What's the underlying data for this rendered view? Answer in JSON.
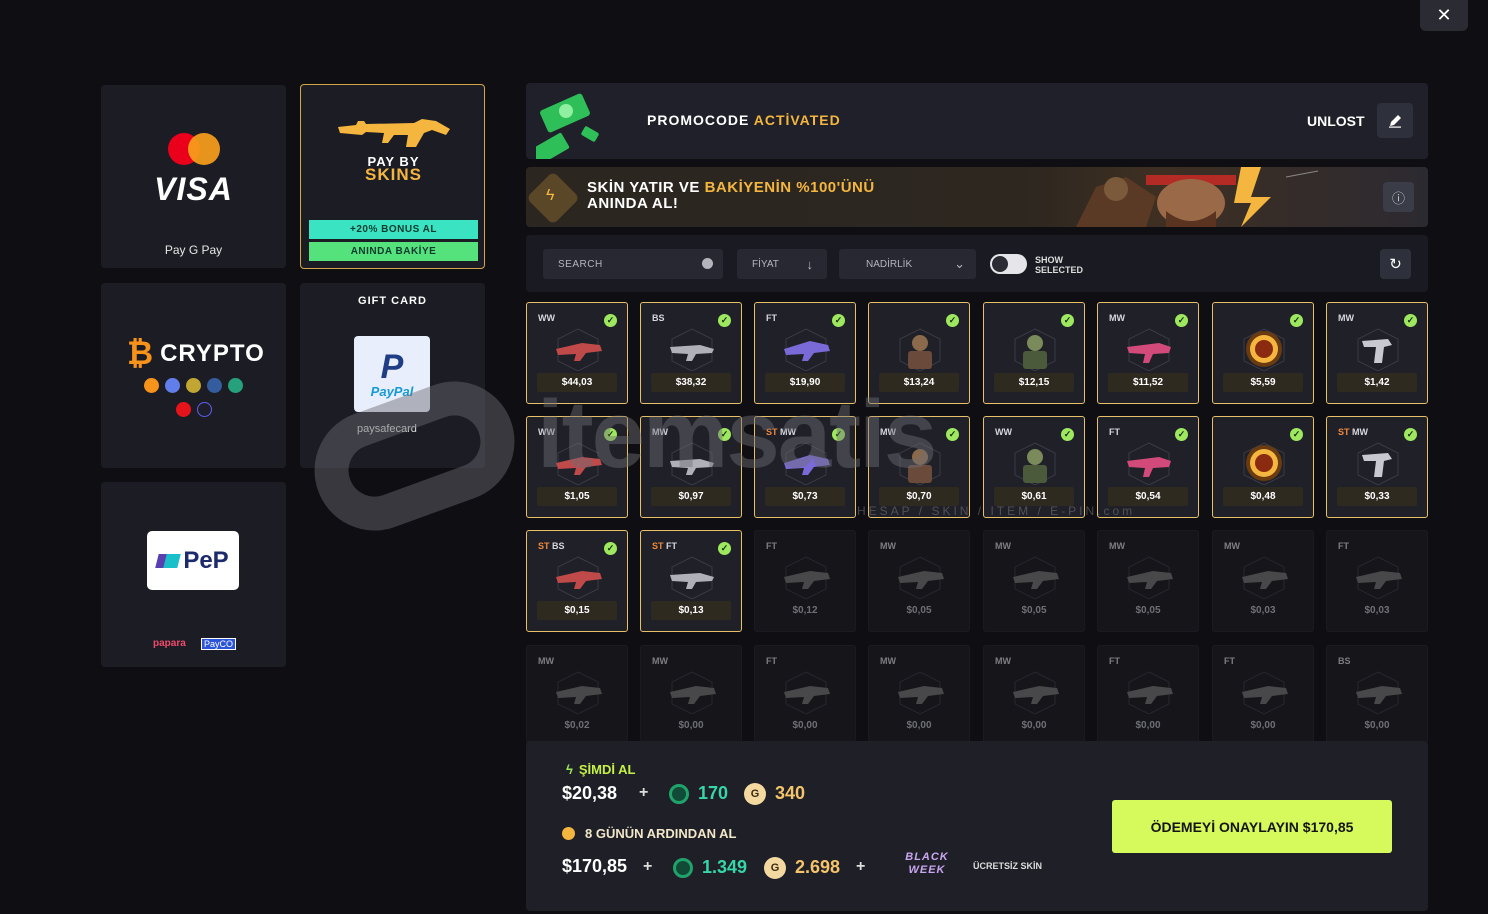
{
  "window": {
    "close_label": "✕"
  },
  "payment_methods": {
    "visa": {
      "brand": "VISA",
      "wallets": "Pay  G Pay"
    },
    "skins": {
      "title_line1": "PAY BY",
      "title_line2": "SKINS",
      "bonus": "+20% BONUS AL",
      "instant": "ANINDA BAKİYE"
    },
    "crypto": {
      "title": "CRYPTO"
    },
    "gift": {
      "title": "GIFT CARD",
      "paypal": "PayPal",
      "paysafe": "paysafecard"
    },
    "pep": {
      "logo": "PeP",
      "papara": "papara",
      "payco": "PayCO"
    }
  },
  "promo": {
    "text_prefix": "PROMOCODE",
    "text_highlight": "ACTİVATED",
    "code": "UNLOST"
  },
  "banner": {
    "line1_prefix": "SKİN YATIR VE",
    "line1_highlight": "BAKİYENİN %100'ÜNÜ",
    "line2": "ANINDA AL!"
  },
  "filters": {
    "search_placeholder": "SEARCH",
    "price_label": "FİYAT",
    "rarity_label": "NADİRLİK",
    "show_selected_line1": "SHOW",
    "show_selected_line2": "SELECTED"
  },
  "items": [
    {
      "cond": "WW",
      "st": "",
      "price": "$44,03",
      "selected": true
    },
    {
      "cond": "BS",
      "st": "",
      "price": "$38,32",
      "selected": true
    },
    {
      "cond": "FT",
      "st": "",
      "price": "$19,90",
      "selected": true
    },
    {
      "cond": "",
      "st": "",
      "price": "$13,24",
      "selected": true
    },
    {
      "cond": "",
      "st": "",
      "price": "$12,15",
      "selected": true
    },
    {
      "cond": "MW",
      "st": "",
      "price": "$11,52",
      "selected": true
    },
    {
      "cond": "",
      "st": "",
      "price": "$5,59",
      "selected": true
    },
    {
      "cond": "MW",
      "st": "",
      "price": "$1,42",
      "selected": true
    },
    {
      "cond": "WW",
      "st": "",
      "price": "$1,05",
      "selected": true
    },
    {
      "cond": "MW",
      "st": "",
      "price": "$0,97",
      "selected": true
    },
    {
      "cond": "MW",
      "st": "ST",
      "price": "$0,73",
      "selected": true
    },
    {
      "cond": "MW",
      "st": "",
      "price": "$0,70",
      "selected": true
    },
    {
      "cond": "WW",
      "st": "",
      "price": "$0,61",
      "selected": true
    },
    {
      "cond": "FT",
      "st": "",
      "price": "$0,54",
      "selected": true
    },
    {
      "cond": "",
      "st": "",
      "price": "$0,48",
      "selected": true
    },
    {
      "cond": "MW",
      "st": "ST",
      "price": "$0,33",
      "selected": true
    },
    {
      "cond": "BS",
      "st": "ST",
      "price": "$0,15",
      "selected": true
    },
    {
      "cond": "FT",
      "st": "ST",
      "price": "$0,13",
      "selected": true
    },
    {
      "cond": "FT",
      "st": "",
      "price": "$0,12",
      "selected": false
    },
    {
      "cond": "MW",
      "st": "",
      "price": "$0,05",
      "selected": false
    },
    {
      "cond": "MW",
      "st": "",
      "price": "$0,05",
      "selected": false
    },
    {
      "cond": "MW",
      "st": "",
      "price": "$0,05",
      "selected": false
    },
    {
      "cond": "MW",
      "st": "",
      "price": "$0,03",
      "selected": false
    },
    {
      "cond": "FT",
      "st": "",
      "price": "$0,03",
      "selected": false
    },
    {
      "cond": "MW",
      "st": "",
      "price": "$0,02",
      "selected": false
    },
    {
      "cond": "MW",
      "st": "",
      "price": "$0,00",
      "selected": false
    },
    {
      "cond": "FT",
      "st": "",
      "price": "$0,00",
      "selected": false
    },
    {
      "cond": "MW",
      "st": "",
      "price": "$0,00",
      "selected": false
    },
    {
      "cond": "MW",
      "st": "",
      "price": "$0,00",
      "selected": false
    },
    {
      "cond": "FT",
      "st": "",
      "price": "$0,00",
      "selected": false
    },
    {
      "cond": "FT",
      "st": "",
      "price": "$0,00",
      "selected": false
    },
    {
      "cond": "BS",
      "st": "",
      "price": "$0,00",
      "selected": false
    }
  ],
  "watermark": {
    "brand": "itemsatis",
    "sub": "HESAP / SKIN / ITEM / E-PIN",
    "com": ".com"
  },
  "footer": {
    "now_label": "ŞİMDİ AL",
    "now_price": "$20,38",
    "now_gems": "170",
    "now_gold": "340",
    "gold_symbol": "G",
    "later_label": "8 GÜNÜN ARDINDAN AL",
    "later_price": "$170,85",
    "later_gems": "1.349",
    "later_gold": "2.698",
    "badge": "BLACK WEEK",
    "free_skin": "ÜCRETSİZ SKİN",
    "confirm": "ÖDEMEYİ ONAYLAYIN $170,85",
    "plus": "+"
  },
  "colors": {
    "accent_gold": "#f4b63e",
    "confirm_green": "#d6f95c",
    "check_green": "#9ee85f",
    "gem_teal": "#36d6a6"
  }
}
